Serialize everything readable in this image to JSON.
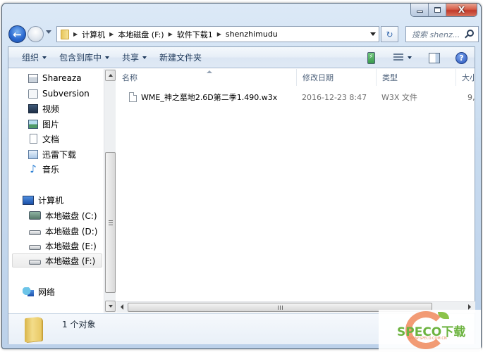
{
  "window": {
    "caption_buttons": {
      "minimize": "minimize",
      "maximize": "maximize",
      "close": "X"
    }
  },
  "navbar": {
    "back_icon": "back-arrow-icon",
    "forward_icon": "forward-arrow-icon",
    "breadcrumbs": [
      "计算机",
      "本地磁盘 (F:)",
      "软件下载1",
      "shenzhimudu"
    ],
    "refresh_glyph": "↻",
    "search_placeholder": "搜索 shenz..."
  },
  "toolbar": {
    "items": [
      {
        "label": "组织",
        "has_dropdown": true
      },
      {
        "label": "包含到库中",
        "has_dropdown": true
      },
      {
        "label": "共享",
        "has_dropdown": true
      },
      {
        "label": "新建文件夹",
        "has_dropdown": false
      }
    ],
    "help_glyph": "?"
  },
  "navpane": {
    "libraries": [
      {
        "label": "Shareaza",
        "icon": "app-icon"
      },
      {
        "label": "Subversion",
        "icon": "svn-icon"
      },
      {
        "label": "视频",
        "icon": "video-icon"
      },
      {
        "label": "图片",
        "icon": "picture-icon"
      },
      {
        "label": "文档",
        "icon": "document-icon"
      },
      {
        "label": "迅雷下载",
        "icon": "xunlei-icon"
      },
      {
        "label": "音乐",
        "icon": "music-icon"
      }
    ],
    "computer": {
      "label": "计算机",
      "icon": "computer-icon"
    },
    "drives": [
      {
        "label": "本地磁盘 (C:)",
        "icon": "system-drive-icon",
        "selected": false
      },
      {
        "label": "本地磁盘 (D:)",
        "icon": "drive-icon",
        "selected": false
      },
      {
        "label": "本地磁盘 (E:)",
        "icon": "drive-icon",
        "selected": false
      },
      {
        "label": "本地磁盘 (F:)",
        "icon": "drive-icon",
        "selected": true
      }
    ],
    "network": {
      "label": "网络",
      "icon": "network-icon"
    }
  },
  "filelist": {
    "columns": [
      "名称",
      "修改日期",
      "类型",
      "大小"
    ],
    "sorted_by": "名称",
    "rows": [
      {
        "name": "WME_神之墓地2.6D第二季1.490.w3x",
        "modified": "2016-12-23 8:47",
        "type": "W3X 文件",
        "size": "9,("
      }
    ]
  },
  "details": {
    "status": "1 个对象"
  },
  "watermark": {
    "text": "SPECO下载",
    "url": "WWW.SPECO.COM.CN"
  }
}
